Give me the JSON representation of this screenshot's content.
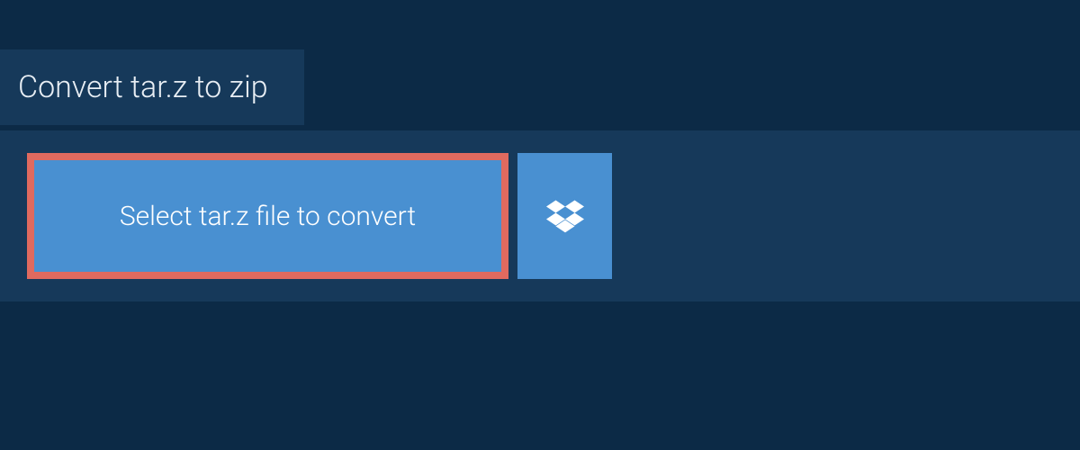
{
  "header": {
    "title": "Convert tar.z to zip"
  },
  "panel": {
    "select_button_label": "Select tar.z file to convert"
  }
}
